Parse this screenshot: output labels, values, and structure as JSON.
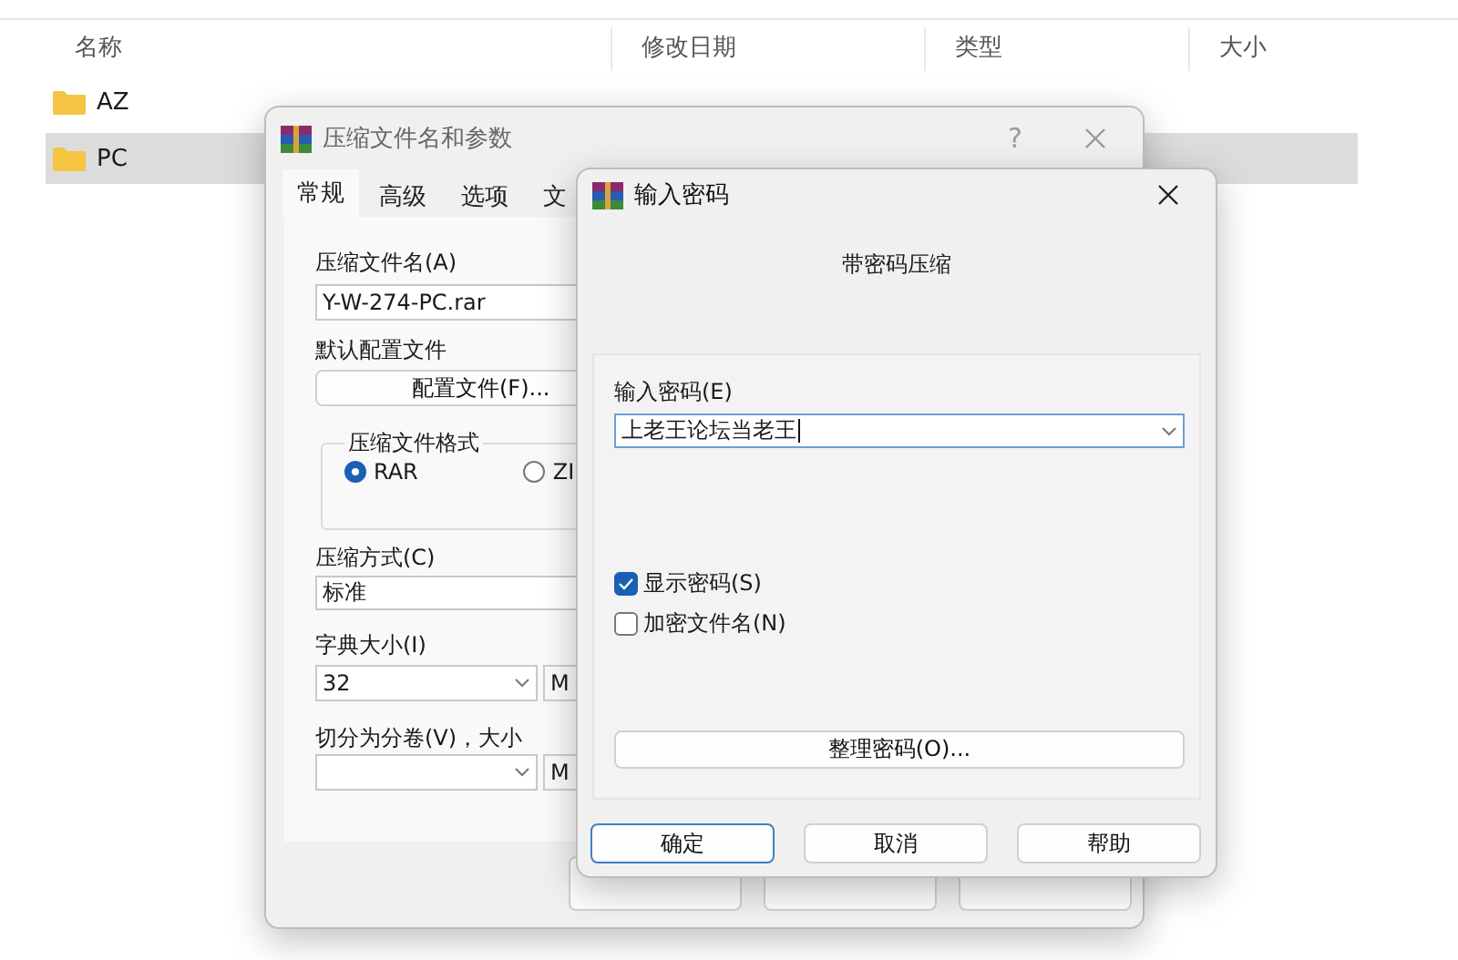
{
  "explorer": {
    "columns": [
      "名称",
      "修改日期",
      "类型",
      "大小"
    ],
    "rows": [
      {
        "name": "AZ",
        "selected": false
      },
      {
        "name": "PC",
        "selected": true
      }
    ]
  },
  "archive_dialog": {
    "title": "压缩文件名和参数",
    "help": "?",
    "tabs": [
      {
        "label": "常规",
        "selected": true
      },
      {
        "label": "高级",
        "selected": false
      },
      {
        "label": "选项",
        "selected": false
      },
      {
        "label": "文",
        "selected": false
      }
    ],
    "archive_name_label": "压缩文件名(A)",
    "archive_name": "Y-W-274-PC.rar",
    "profile_label": "默认配置文件",
    "profile_button": "配置文件(F)...",
    "format_group": "压缩文件格式",
    "formats": [
      {
        "label": "RAR",
        "selected": true
      },
      {
        "label": "ZI",
        "selected": false
      }
    ],
    "method_label": "压缩方式(C)",
    "method": "标准",
    "dict_label": "字典大小(I)",
    "dict": "32",
    "dict_unit": "M",
    "split_label": "切分为分卷(V)，大小",
    "split_unit": "M"
  },
  "password_dialog": {
    "title": "输入密码",
    "subtitle": "带密码压缩",
    "password_label": "输入密码(E)",
    "password": "上老王论坛当老王",
    "options": [
      {
        "label": "显示密码(S)",
        "checked": true
      },
      {
        "label": "加密文件名(N)",
        "checked": false
      }
    ],
    "organize_button": "整理密码(O)...",
    "buttons": [
      {
        "label": "确定",
        "focused": true
      },
      {
        "label": "取消",
        "focused": false
      },
      {
        "label": "帮助",
        "focused": false
      }
    ]
  }
}
